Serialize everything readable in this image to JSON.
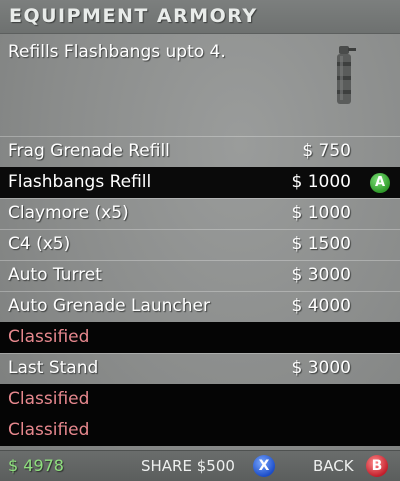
{
  "header": {
    "title": "EQUIPMENT ARMORY"
  },
  "description": "Refills Flashbangs upto 4.",
  "item_image": {
    "icon": "flashbang-grenade-icon"
  },
  "items": [
    {
      "name": "Frag Grenade Refill",
      "price": "$ 750",
      "state": "normal"
    },
    {
      "name": "Flashbangs Refill",
      "price": "$ 1000",
      "state": "selected"
    },
    {
      "name": "Claymore (x5)",
      "price": "$ 1000",
      "state": "normal"
    },
    {
      "name": "C4 (x5)",
      "price": "$ 1500",
      "state": "normal"
    },
    {
      "name": "Auto Turret",
      "price": "$ 3000",
      "state": "normal"
    },
    {
      "name": "Auto Grenade Launcher",
      "price": "$ 4000",
      "state": "normal"
    },
    {
      "name": "Classified",
      "price": "",
      "state": "classified"
    },
    {
      "name": "Last Stand",
      "price": "$ 3000",
      "state": "normal"
    },
    {
      "name": "Classified",
      "price": "",
      "state": "classified"
    },
    {
      "name": "Classified",
      "price": "",
      "state": "classified"
    }
  ],
  "select_button": {
    "glyph": "A",
    "color": "#3fae3a"
  },
  "footer": {
    "money": "$ 4978",
    "share_label": "SHARE $500",
    "share_button": {
      "glyph": "X",
      "color": "#2a5fd6"
    },
    "back_label": "BACK",
    "back_button": {
      "glyph": "B",
      "color": "#d02a36"
    }
  },
  "colors": {
    "money": "#8fe07e",
    "classified_text": "#e7888e",
    "selected_row": "#0a0a0a"
  }
}
